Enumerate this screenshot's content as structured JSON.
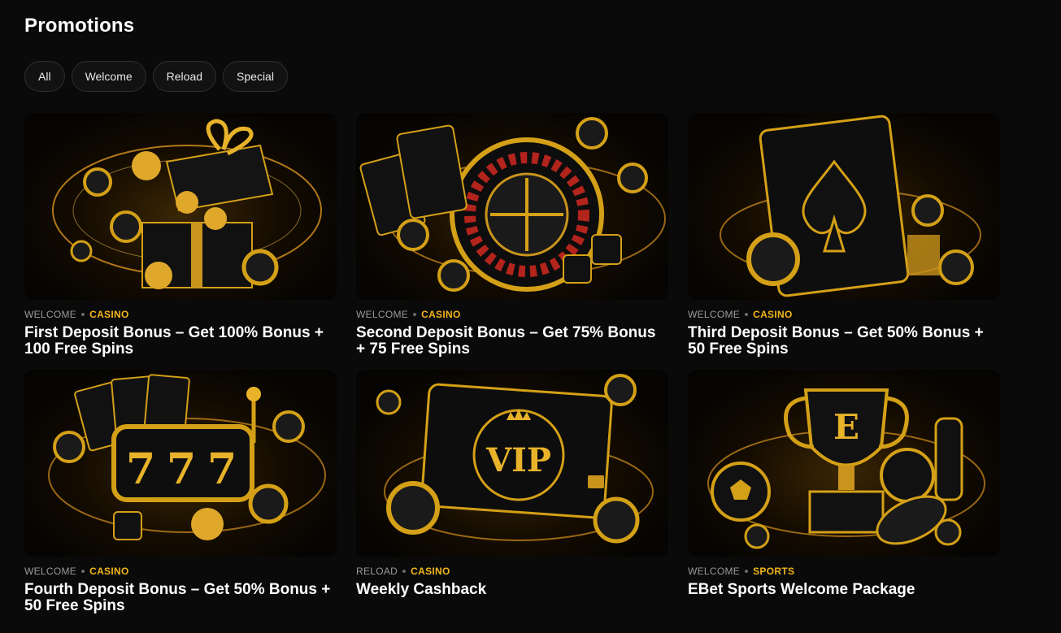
{
  "page": {
    "title": "Promotions"
  },
  "filters": [
    {
      "label": "All"
    },
    {
      "label": "Welcome"
    },
    {
      "label": "Reload"
    },
    {
      "label": "Special"
    }
  ],
  "promotions": [
    {
      "type": "WELCOME",
      "category": "CASINO",
      "title": "First Deposit Bonus – Get 100% Bonus + 100 Free Spins",
      "artwork": "gift-box-coins-icon"
    },
    {
      "type": "WELCOME",
      "category": "CASINO",
      "title": "Second Deposit Bonus – Get 75% Bonus + 75 Free Spins",
      "artwork": "roulette-wheel-cards-icon"
    },
    {
      "type": "WELCOME",
      "category": "CASINO",
      "title": "Third Deposit Bonus – Get 50% Bonus + 50 Free Spins",
      "artwork": "ace-of-spades-icon"
    },
    {
      "type": "WELCOME",
      "category": "CASINO",
      "title": "Fourth Deposit Bonus – Get 50% Bonus + 50 Free Spins",
      "artwork": "slot-machine-777-icon"
    },
    {
      "type": "RELOAD",
      "category": "CASINO",
      "title": "Weekly Cashback",
      "artwork": "vip-card-icon",
      "vip_text": "VIP"
    },
    {
      "type": "WELCOME",
      "category": "SPORTS",
      "title": "EBet Sports Welcome Package",
      "artwork": "trophy-sports-balls-icon",
      "trophy_letter": "E"
    }
  ],
  "colors": {
    "accent": "#f2b51c",
    "background": "#0a0a0a",
    "chip_border": "#2f2f2f",
    "muted": "#9a9a9a"
  }
}
